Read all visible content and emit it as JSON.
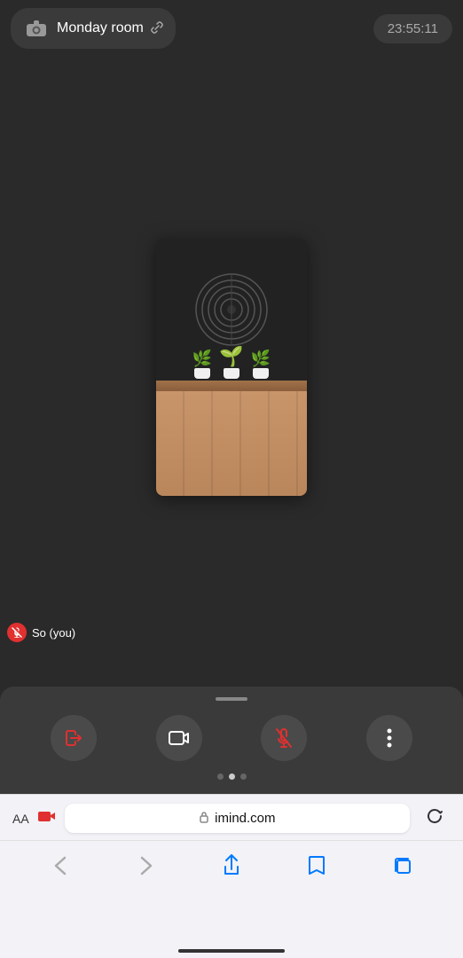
{
  "header": {
    "room_name": "Monday room",
    "time": "23:55:11",
    "camera_icon": "📷",
    "link_icon": "⛓"
  },
  "video": {
    "user_label": "So  (you)",
    "mic_off_icon": "🎤"
  },
  "toolbar": {
    "leave_icon": "👈",
    "camera_icon": "📹",
    "mic_icon": "🎤",
    "more_icon": "⋮",
    "dots": [
      false,
      true,
      false
    ]
  },
  "browser": {
    "aa_label": "AA",
    "camera_label": "🎥",
    "domain": "imind.com",
    "lock_icon": "🔒",
    "refresh_icon": "↺",
    "back_icon": "‹",
    "forward_icon": "›",
    "share_icon": "⬆",
    "bookmarks_icon": "📖",
    "tabs_icon": "⧉"
  }
}
